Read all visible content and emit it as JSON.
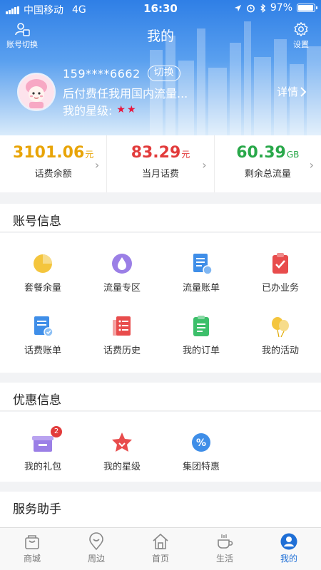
{
  "status_bar": {
    "carrier": "中国移动",
    "network": "4G",
    "time": "16:30",
    "battery": "97%",
    "battery_level": 0.97
  },
  "header": {
    "switch_account_label": "账号切换",
    "title": "我的",
    "settings_label": "设置",
    "phone": "159****6662",
    "switch_button": "切换",
    "plan": "后付费任我用国内流量...",
    "star_label": "我的星级:",
    "star_count": 2,
    "details_label": "详情"
  },
  "stats": [
    {
      "value": "3101.06",
      "unit": "元",
      "label": "话费余额",
      "color": "#e8a407"
    },
    {
      "value": "83.29",
      "unit": "元",
      "label": "当月话费",
      "color": "#e23b3b"
    },
    {
      "value": "60.39",
      "unit": "GB",
      "label": "剩余总流量",
      "color": "#29a84a"
    }
  ],
  "account_section": {
    "title": "账号信息",
    "items": [
      {
        "label": "套餐余量",
        "icon": "pie-chart-icon"
      },
      {
        "label": "流量专区",
        "icon": "data-drop-icon"
      },
      {
        "label": "流量账单",
        "icon": "data-bill-icon"
      },
      {
        "label": "已办业务",
        "icon": "clipboard-check-icon"
      },
      {
        "label": "话费账单",
        "icon": "phone-bill-icon"
      },
      {
        "label": "话费历史",
        "icon": "bill-history-icon"
      },
      {
        "label": "我的订单",
        "icon": "order-icon"
      },
      {
        "label": "我的活动",
        "icon": "balloon-icon"
      }
    ]
  },
  "promo_section": {
    "title": "优惠信息",
    "items": [
      {
        "label": "我的礼包",
        "icon": "gift-icon",
        "badge": "2"
      },
      {
        "label": "我的星级",
        "icon": "star-badge-icon"
      },
      {
        "label": "集团特惠",
        "icon": "percent-icon"
      }
    ]
  },
  "service_section": {
    "title": "服务助手"
  },
  "tabbar": [
    {
      "label": "商城",
      "icon": "shopping-bag-icon"
    },
    {
      "label": "周边",
      "icon": "location-pin-icon"
    },
    {
      "label": "首页",
      "icon": "home-icon"
    },
    {
      "label": "生活",
      "icon": "coffee-cup-icon"
    },
    {
      "label": "我的",
      "icon": "user-icon",
      "active": true
    }
  ]
}
